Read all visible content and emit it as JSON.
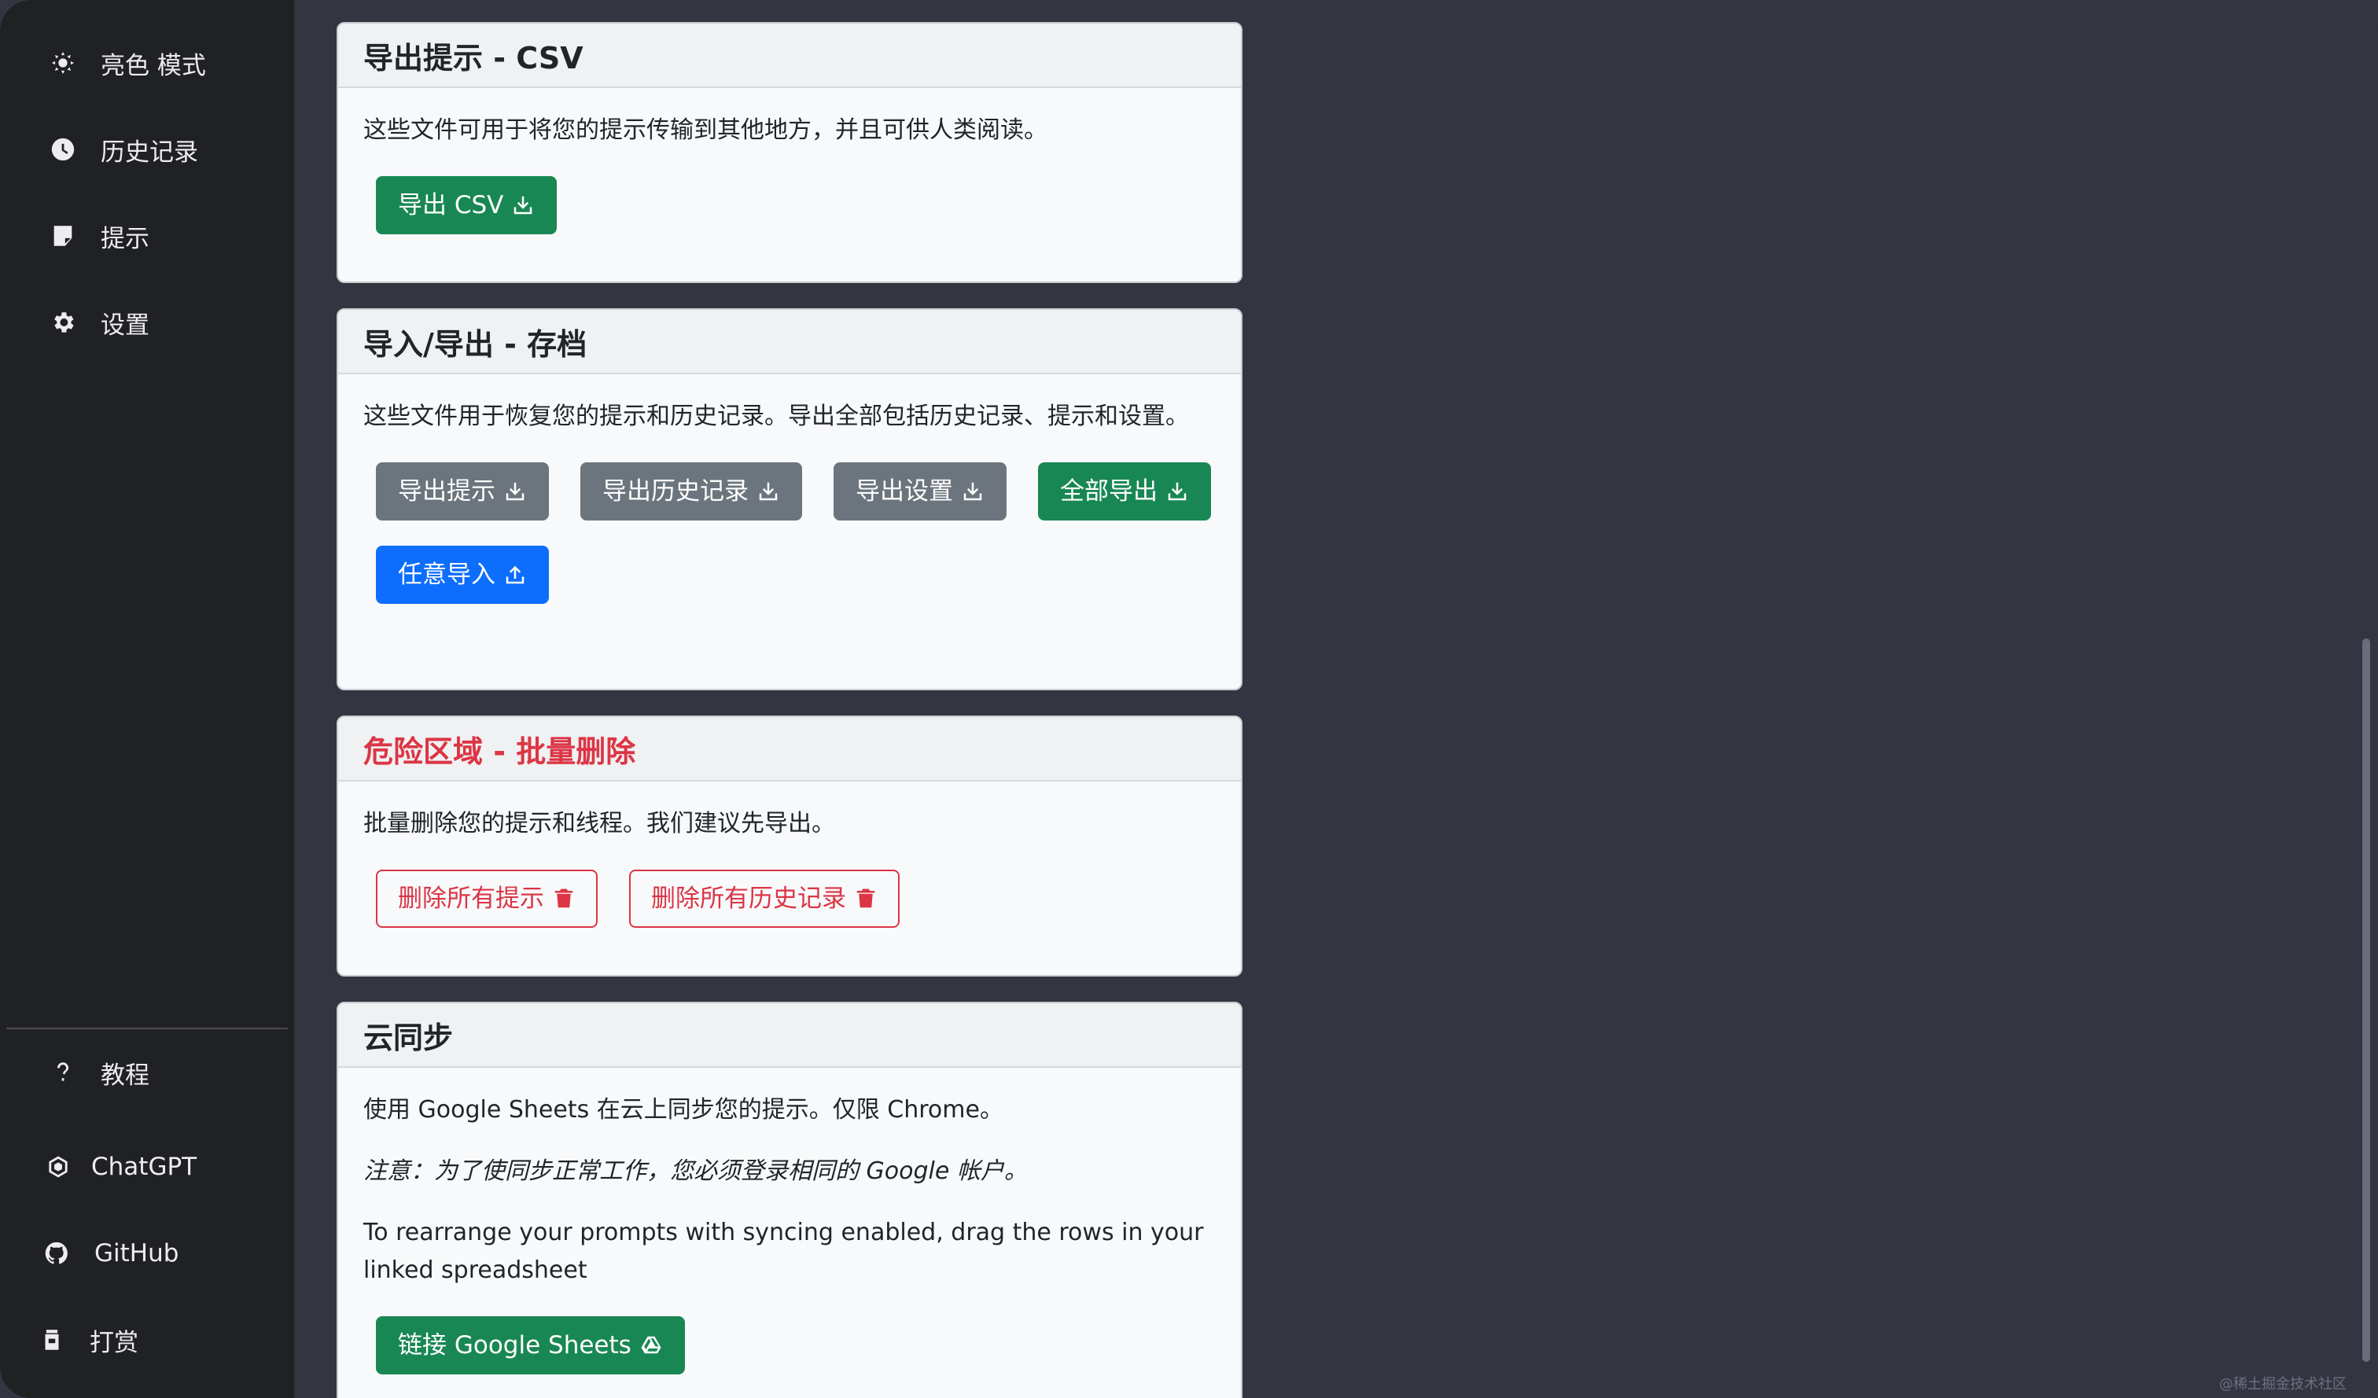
{
  "sidebar": {
    "top_items": [
      {
        "label": "亮色 模式",
        "icon": "sun-gear-icon"
      },
      {
        "label": "历史记录",
        "icon": "clock-icon"
      },
      {
        "label": "提示",
        "icon": "note-icon"
      },
      {
        "label": "设置",
        "icon": "gear-icon"
      }
    ],
    "bottom_items": [
      {
        "label": "教程",
        "icon": "question-icon"
      },
      {
        "label": "ChatGPT",
        "icon": "openai-icon"
      },
      {
        "label": "GitHub",
        "icon": "github-icon"
      },
      {
        "label": "打赏",
        "icon": "jar-icon"
      }
    ]
  },
  "cards": {
    "csv": {
      "title": "导出提示 - CSV",
      "description": "这些文件可用于将您的提示传输到其他地方，并且可供人类阅读。",
      "export_csv": "导出 CSV"
    },
    "archive": {
      "title": "导入/导出 - 存档",
      "description": "这些文件用于恢复您的提示和历史记录。导出全部包括历史记录、提示和设置。",
      "export_prompts": "导出提示",
      "export_history": "导出历史记录",
      "export_settings": "导出设置",
      "export_all": "全部导出",
      "import_any": "任意导入"
    },
    "danger": {
      "title": "危险区域 - 批量删除",
      "description": "批量删除您的提示和线程。我们建议先导出。",
      "delete_prompts": "删除所有提示",
      "delete_history": "删除所有历史记录"
    },
    "sync": {
      "title": "云同步",
      "line1": "使用 Google Sheets 在云上同步您的提示。仅限 Chrome。",
      "note": "注意：为了使同步正常工作，您必须登录相同的 Google 帐户。",
      "rearrange": "To rearrange your prompts with syncing enabled, drag the rows in your linked spreadsheet",
      "link_button": "链接 Google Sheets"
    }
  },
  "watermark": "@稀土掘金技术社区"
}
